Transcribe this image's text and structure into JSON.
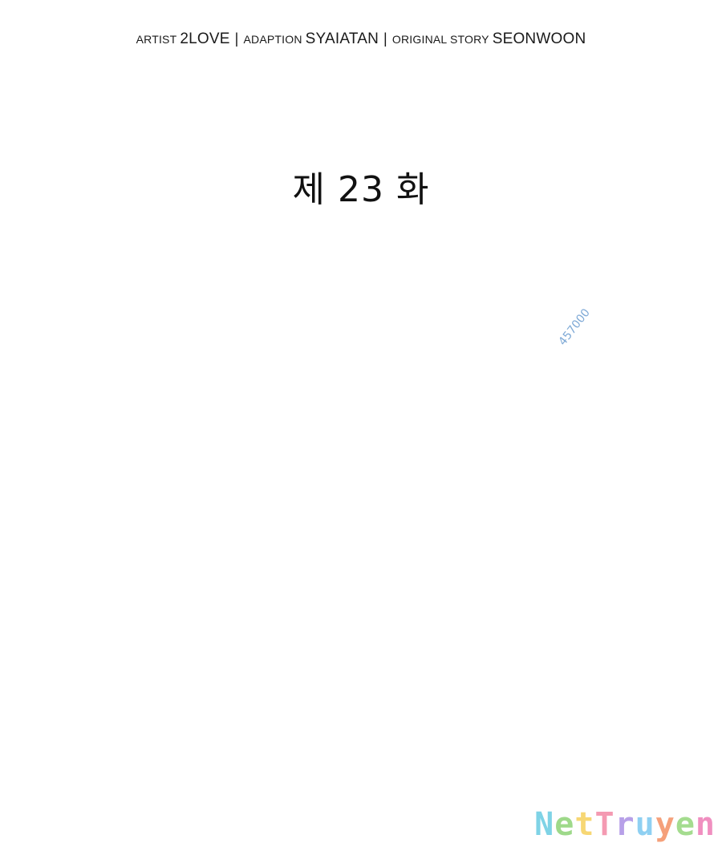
{
  "credits": {
    "artist_role": "ARTIST",
    "artist_name": "2LOVE",
    "separator": "|",
    "adaption_role": "ADAPTION",
    "adaption_name": "SYAIATAN",
    "story_role": "ORIGINAL STORY",
    "story_name": "SEONWOON"
  },
  "chapter_title": "제 23 화",
  "watermark_id": "457000",
  "brand": {
    "letters": [
      {
        "char": "N",
        "color": "#7fd3e6"
      },
      {
        "char": "e",
        "color": "#9ed98a"
      },
      {
        "char": "t",
        "color": "#f7d774"
      },
      {
        "char": "T",
        "color": "#f49ab2"
      },
      {
        "char": "r",
        "color": "#b7a0e8"
      },
      {
        "char": "u",
        "color": "#8fd0f2"
      },
      {
        "char": "y",
        "color": "#f5a07a"
      },
      {
        "char": "e",
        "color": "#a4dc8f"
      },
      {
        "char": "n",
        "color": "#f08fc0"
      }
    ]
  },
  "top_mark": "'"
}
